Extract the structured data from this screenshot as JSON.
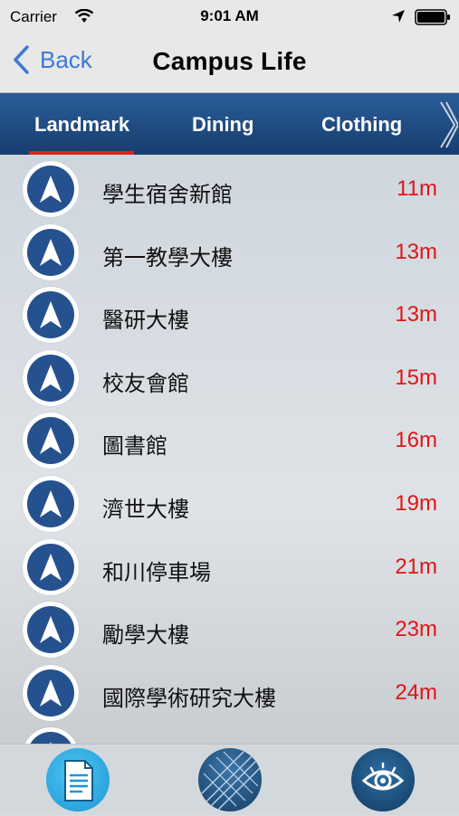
{
  "status": {
    "carrier": "Carrier",
    "time": "9:01 AM"
  },
  "nav": {
    "back_label": "Back",
    "title": "Campus Life"
  },
  "tabs": [
    "Landmark",
    "Dining",
    "Clothing"
  ],
  "places": [
    {
      "name": "學生宿舍新館",
      "distance": "11m"
    },
    {
      "name": "第一教學大樓",
      "distance": "13m"
    },
    {
      "name": "醫研大樓",
      "distance": "13m"
    },
    {
      "name": "校友會館",
      "distance": "15m"
    },
    {
      "name": "圖書館",
      "distance": "16m"
    },
    {
      "name": "濟世大樓",
      "distance": "19m"
    },
    {
      "name": "和川停車場",
      "distance": "21m"
    },
    {
      "name": "勵學大樓",
      "distance": "23m"
    },
    {
      "name": "國際學術研究大樓",
      "distance": "24m"
    }
  ],
  "colors": {
    "accent": "#3a7bd5",
    "tab_bg": "#1f4d86",
    "distance": "#e01515",
    "underline": "#e02020"
  },
  "bottom_icons": [
    "document-icon",
    "building-icon",
    "eye-icon"
  ]
}
